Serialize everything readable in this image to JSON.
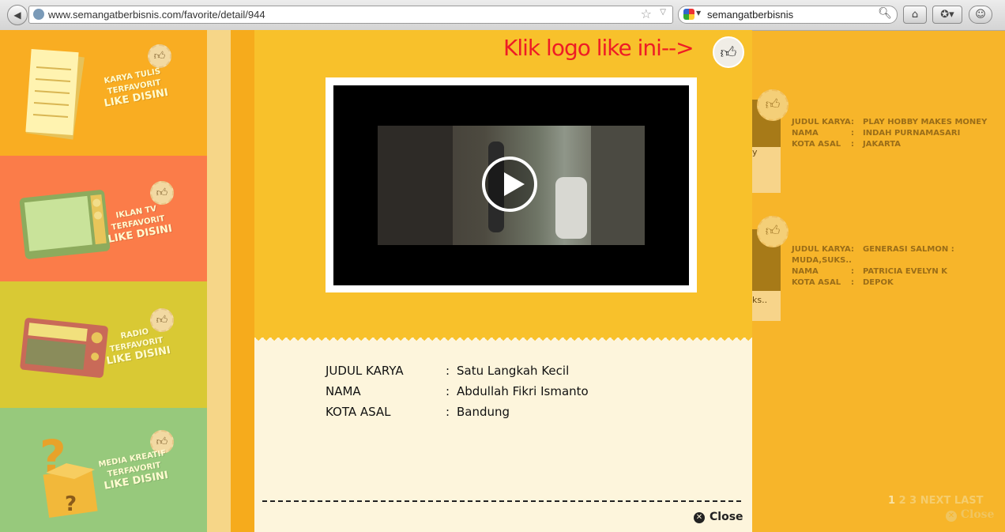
{
  "browser": {
    "url": "www.semangatberbisnis.com/favorite/detail/944",
    "search_text": "semangatberbisnis"
  },
  "sidebar": {
    "categories": [
      {
        "line1": "KARYA TULIS",
        "line2": "TERFAVORIT",
        "line3": "LIKE DISINI",
        "color": "#f9ad22"
      },
      {
        "line1": "IKLAN TV",
        "line2": "TERFAVORIT",
        "line3": "LIKE DISINI",
        "color": "#fb7c49"
      },
      {
        "line1": "RADIO",
        "line2": "TERFAVORIT",
        "line3": "LIKE DISINI",
        "color": "#d9c934"
      },
      {
        "line1": "MEDIA KREATIF",
        "line2": "TERFAVORIT",
        "line3": "LIKE DISINI",
        "color": "#97c97c"
      }
    ]
  },
  "modal": {
    "instruction": "Klik logo like ini-->",
    "details": [
      {
        "key": "JUDUL KARYA",
        "colon": ":",
        "value": "Satu Langkah Kecil"
      },
      {
        "key": "NAMA",
        "colon": ":",
        "value": "Abdullah Fikri Ismanto"
      },
      {
        "key": "KOTA ASAL",
        "colon": ":",
        "value": "Bandung"
      }
    ],
    "close_label": "Close"
  },
  "background_list": [
    {
      "thumb_caption": "y",
      "rows": [
        {
          "key": "JUDUL KARYA",
          "value": "PLAY HOBBY MAKES MONEY"
        },
        {
          "key": "NAMA",
          "value": "INDAH PURNAMASARI"
        },
        {
          "key": "KOTA ASAL",
          "value": "JAKARTA"
        }
      ]
    },
    {
      "thumb_caption": "ks..",
      "rows": [
        {
          "key": "JUDUL KARYA",
          "value": "GENERASI SALMON : MUDA,SUKS.."
        },
        {
          "key": "NAMA",
          "value": "PATRICIA EVELYN K"
        },
        {
          "key": "KOTA ASAL",
          "value": "DEPOK"
        }
      ]
    }
  ],
  "pagination": {
    "pages": [
      "1",
      "2",
      "3"
    ],
    "next": "NEXT",
    "last": "LAST"
  },
  "background_close_label": "Close"
}
